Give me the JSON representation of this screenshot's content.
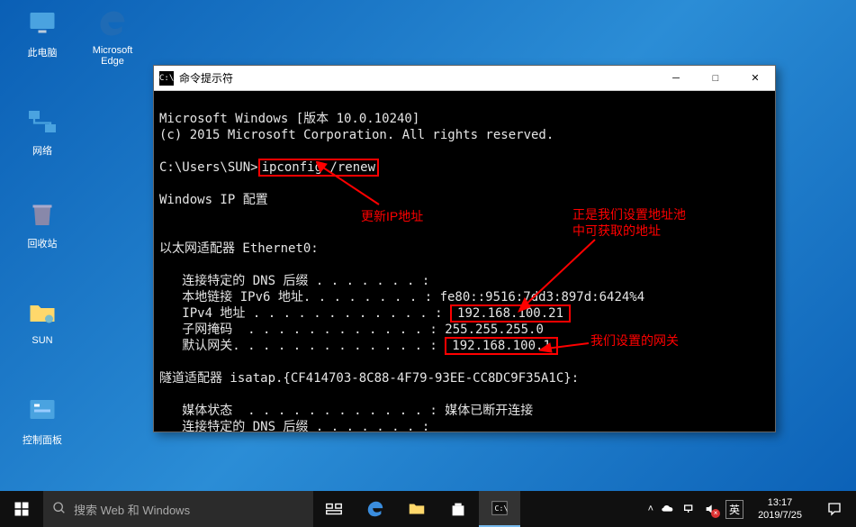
{
  "desktop_icons": {
    "this_pc": "此电脑",
    "edge": "Microsoft Edge",
    "network": "网络",
    "recycle": "回收站",
    "sun": "SUN",
    "control_panel": "控制面板"
  },
  "cmd": {
    "title": "命令提示符",
    "line1": "Microsoft Windows [版本 10.0.10240]",
    "line2": "(c) 2015 Microsoft Corporation. All rights reserved.",
    "prompt": "C:\\Users\\SUN>",
    "command": "ipconfig /renew",
    "heading": "Windows IP 配置",
    "adapter_eth": "以太网适配器 Ethernet0:",
    "dns_suffix_label": "   连接特定的 DNS 后缀 . . . . . . . :",
    "ipv6_label": "   本地链接 IPv6 地址. . . . . . . . : ",
    "ipv6_value": "fe80::9516:7dd3:897d:6424%4",
    "ipv4_label": "   IPv4 地址 . . . . . . . . . . . . : ",
    "ipv4_value": "192.168.100.21",
    "mask_label": "   子网掩码  . . . . . . . . . . . . : ",
    "mask_value": "255.255.255.0",
    "gateway_label": "   默认网关. . . . . . . . . . . . . : ",
    "gateway_value": "192.168.100.1",
    "tunnel": "隧道适配器 isatap.{CF414703-8C88-4F79-93EE-CC8DC9F35A1C}:",
    "media_label": "   媒体状态  . . . . . . . . . . . . : ",
    "media_value": "媒体已断开连接",
    "dns_suffix2": "   连接特定的 DNS 后缀 . . . . . . . :"
  },
  "annotations": {
    "renew": "更新IP地址",
    "pool": "正是我们设置地址池中可获取的地址",
    "gateway": "我们设置的网关"
  },
  "taskbar": {
    "search_placeholder": "搜索 Web 和 Windows",
    "ime": "英",
    "time": "13:17",
    "date": "2019/7/25"
  }
}
